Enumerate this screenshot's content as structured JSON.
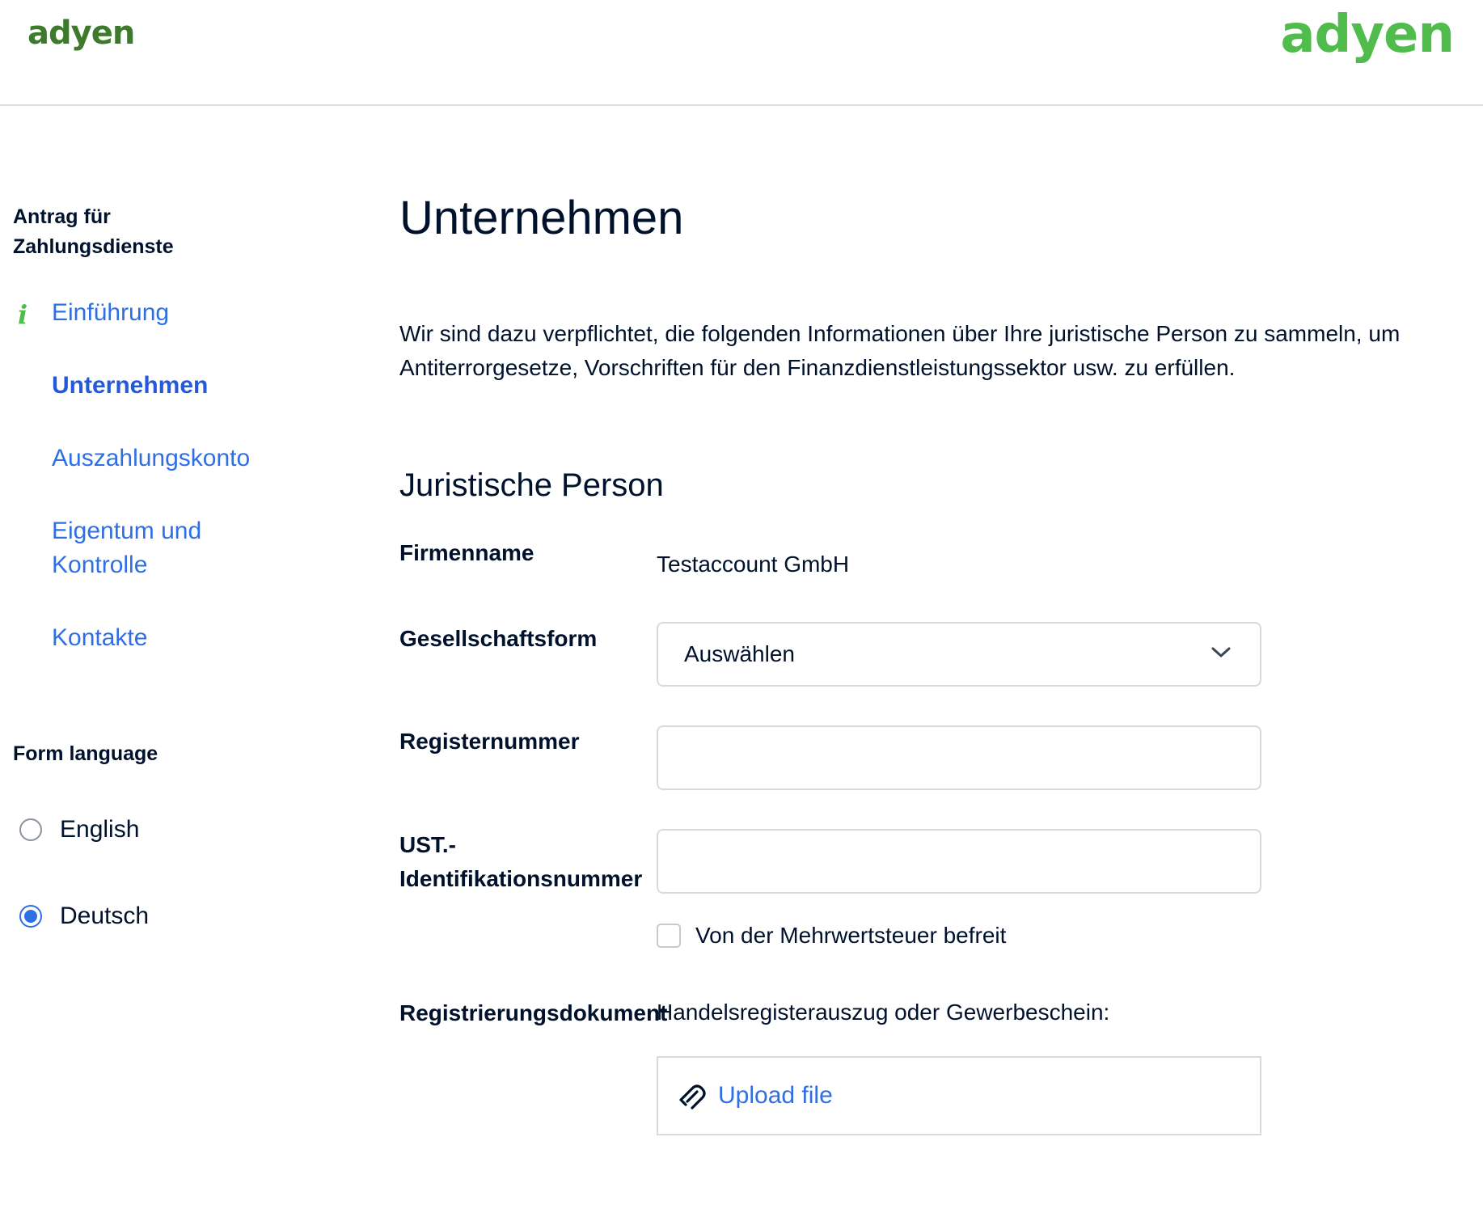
{
  "header": {
    "logo_left": "adyen",
    "logo_right": "adyen"
  },
  "sidebar": {
    "title": "Antrag für Zahlungsdienste",
    "nav": [
      {
        "label": "Einführung",
        "icon": "info-icon"
      },
      {
        "label": "Unternehmen",
        "active": true
      },
      {
        "label": "Auszahlungskonto"
      },
      {
        "label": "Eigentum und Kontrolle"
      },
      {
        "label": "Kontakte"
      }
    ],
    "language": {
      "title": "Form language",
      "options": [
        {
          "label": "English",
          "checked": false
        },
        {
          "label": "Deutsch",
          "checked": true
        }
      ]
    }
  },
  "main": {
    "title": "Unternehmen",
    "intro": "Wir sind dazu verpflichtet, die folgenden Informationen über Ihre juristische Person zu sammeln, um Antiterrorgesetze, Vorschriften für den Finanzdienstleistungssektor usw. zu erfüllen.",
    "section_title": "Juristische Person",
    "fields": {
      "company_name": {
        "label": "Firmenname",
        "value": "Testaccount GmbH"
      },
      "legal_form": {
        "label": "Gesellschaftsform",
        "value": "Auswählen"
      },
      "register_number": {
        "label": "Registernummer",
        "value": ""
      },
      "vat_id": {
        "label": "UST.-Identifikationsnummer",
        "label_line1": "UST.-",
        "label_line2": "Identifikationsnummer",
        "value": ""
      },
      "vat_exempt": {
        "label": "Von der Mehrwertsteuer befreit",
        "checked": false
      },
      "registration_doc": {
        "label": "Registrierungsdokument",
        "hint": "Handelsregisterauszug oder Gewerbeschein:",
        "upload_label": "Upload file"
      }
    }
  },
  "colors": {
    "brand_green": "#4fbc4b",
    "link_blue": "#2f6fe4",
    "text": "#00112c"
  }
}
